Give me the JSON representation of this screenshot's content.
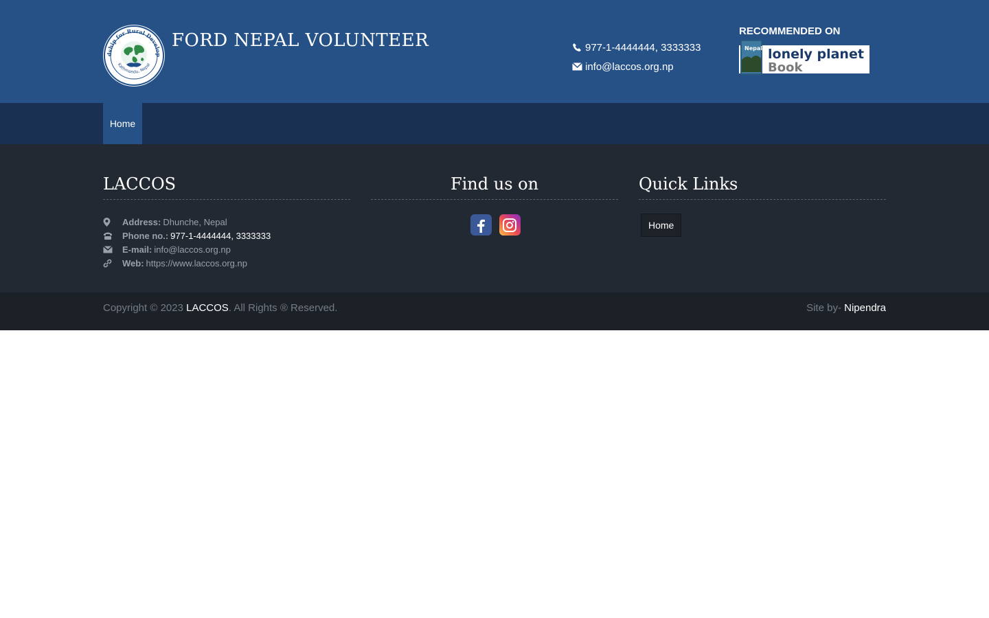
{
  "header": {
    "logo_text_top": "Friendship for Rural Development",
    "logo_text_bottom": "Kathmandu, Nepal",
    "site_title": "FORD NEPAL VOLUNTEER",
    "phone": "977-1-4444444, 3333333",
    "email": "info@laccos.org.np",
    "recommended_label": "RECOMMENDED ON",
    "badge_line1": "lonely planet",
    "badge_line2": "Book",
    "badge_cover": "Nepal"
  },
  "nav": {
    "items": [
      {
        "label": "Home"
      }
    ]
  },
  "footer": {
    "about": {
      "title": "LACCOS",
      "address_label": "Address:",
      "address": "Dhunche, Nepal",
      "phone_label": "Phone no.:",
      "phone": "977-1-4444444, 3333333",
      "email_label": "E-mail:",
      "email": "info@laccos.org.np",
      "web_label": "Web:",
      "web": "https://www.laccos.org.np"
    },
    "social": {
      "title": "Find us on"
    },
    "quick_links": {
      "title": "Quick Links",
      "items": [
        {
          "label": "Home"
        }
      ]
    }
  },
  "bottom": {
    "copy_prefix": "Copyright © 2023",
    "copy_brand": "LACCOS",
    "copy_suffix": ". All Rights ® Reserved.",
    "credit_prefix": "Site by-",
    "credit_name": "Nipendra"
  },
  "colors": {
    "header_bg": "#265187",
    "nav_bg": "#1a3052",
    "footer_bg": "#232932",
    "bottom_bg": "#1c2027"
  }
}
